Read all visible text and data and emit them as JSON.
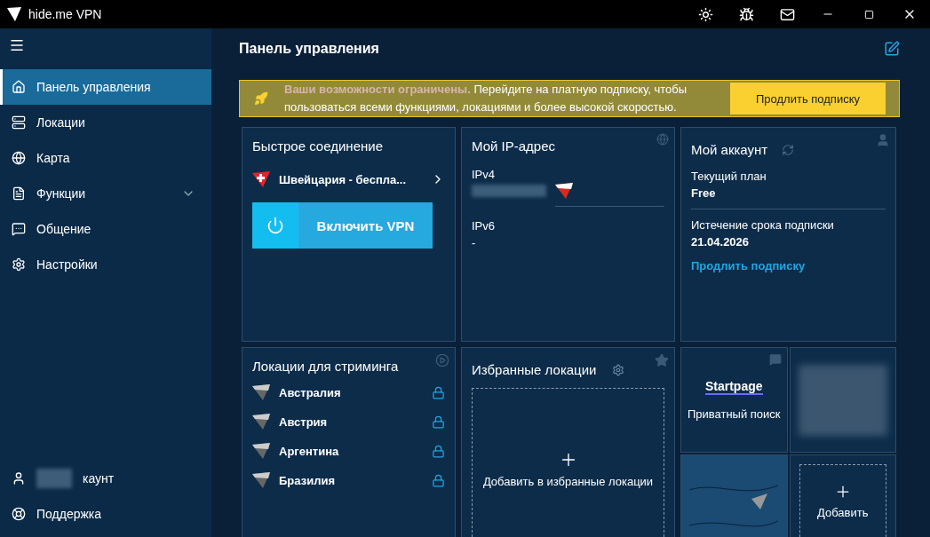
{
  "window": {
    "title": "hide.me VPN"
  },
  "sidebar": {
    "items": [
      {
        "label": "Панель управления",
        "selected": true,
        "kind": "home"
      },
      {
        "label": "Локации",
        "selected": false,
        "kind": "locations"
      },
      {
        "label": "Карта",
        "selected": false,
        "kind": "map"
      },
      {
        "label": "Функции",
        "selected": false,
        "kind": "features",
        "expanded": false
      },
      {
        "label": "Общение",
        "selected": false,
        "kind": "chat"
      },
      {
        "label": "Настройки",
        "selected": false,
        "kind": "settings"
      }
    ],
    "bottom": [
      {
        "label": "каунт",
        "kind": "account"
      },
      {
        "label": "Поддержка",
        "kind": "support"
      }
    ]
  },
  "page": {
    "title": "Панель управления"
  },
  "banner": {
    "highlight": "Ваши возможности ограничены.",
    "text": "Перейдите на платную подписку, чтобы пользоваться всеми функциями, локациями и более высокой скоростью.",
    "button": "Продлить подписку"
  },
  "quick_connect": {
    "title": "Быстрое соединение",
    "location": "Швейцария - беспла...",
    "button": "Включить VPN"
  },
  "ip": {
    "title": "Мой IP-адрес",
    "ipv4_label": "IPv4",
    "ipv6_label": "IPv6",
    "ipv6_value": "-"
  },
  "account": {
    "title": "Мой аккаунт",
    "plan_label": "Текущий план",
    "plan": "Free",
    "expiry_label": "Истечение срока подписки",
    "expiry": "21.04.2026",
    "link": "Продлить подписку"
  },
  "streaming": {
    "title": "Локации для стриминга",
    "locations": [
      {
        "name": "Австралия",
        "locked": true
      },
      {
        "name": "Австрия",
        "locked": true
      },
      {
        "name": "Аргентина",
        "locked": true
      },
      {
        "name": "Бразилия",
        "locked": true
      }
    ]
  },
  "favorites": {
    "title": "Избранные локации",
    "add_label": "Добавить в избранные локации"
  },
  "tiles": [
    {
      "kind": "startpage",
      "logo": "Startpage",
      "label": "Приватный поиск"
    },
    {
      "kind": "blurred"
    },
    {
      "kind": "map"
    },
    {
      "kind": "add",
      "label": "Добавить"
    }
  ]
}
